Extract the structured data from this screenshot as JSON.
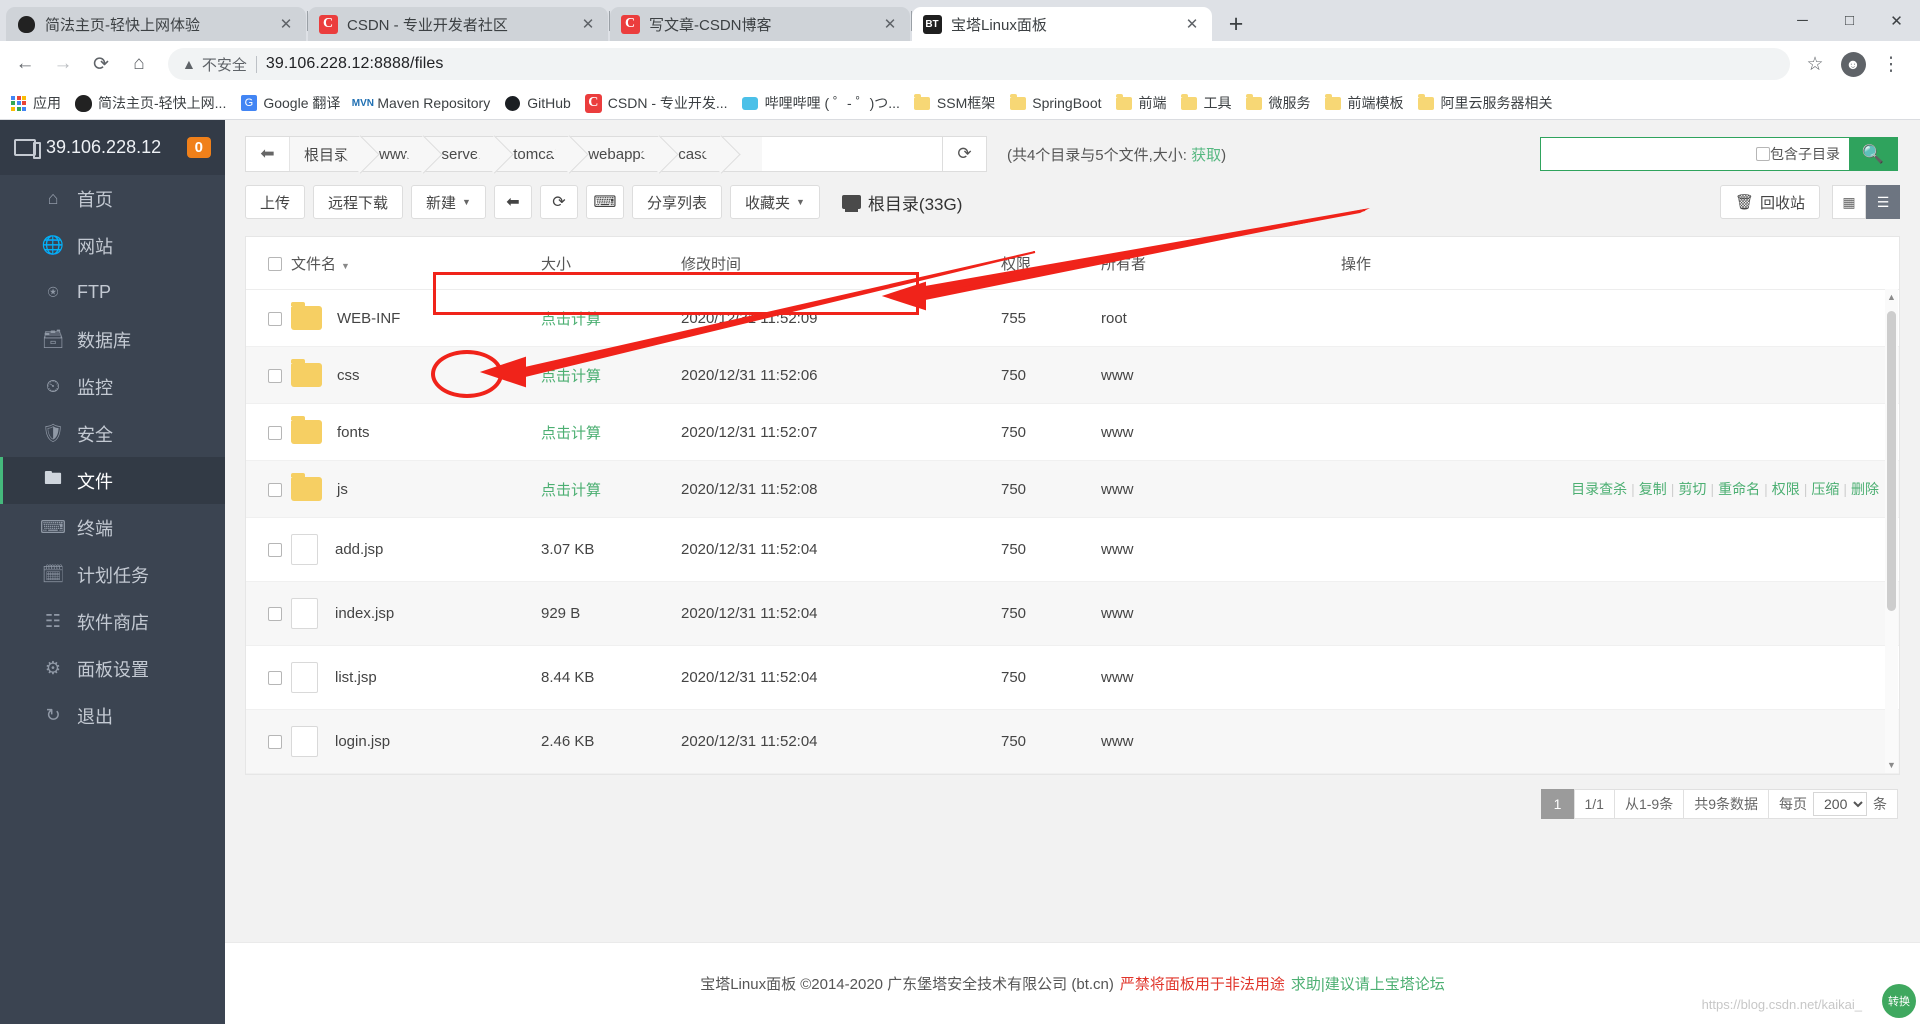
{
  "browser": {
    "tabs": [
      {
        "title": "简法主页-轻快上网体验",
        "favicon": "simplehome-icon",
        "active": false
      },
      {
        "title": "CSDN - 专业开发者社区",
        "favicon": "csdn-icon",
        "active": false
      },
      {
        "title": "写文章-CSDN博客",
        "favicon": "csdn-icon",
        "active": false
      },
      {
        "title": "宝塔Linux面板",
        "favicon": "bt-panel-icon",
        "active": true
      }
    ],
    "new_tab_label": "+",
    "window_controls": [
      "minimize",
      "maximize",
      "close"
    ],
    "nav": {
      "back": "back-arrow-icon",
      "forward": "forward-arrow-icon",
      "reload": "reload-icon",
      "home": "home-icon",
      "security_warning_icon": "warning-triangle-icon",
      "security_label": "不安全",
      "url": "39.106.228.12:8888/files",
      "star": "bookmark-star-icon",
      "profile": "profile-avatar-icon",
      "menu": "three-dot-menu-icon"
    },
    "bookmarks": [
      {
        "label": "应用",
        "icon": "apps-grid-icon"
      },
      {
        "label": "简法主页-轻快上网...",
        "icon": "simplehome-icon"
      },
      {
        "label": "Google 翻译",
        "icon": "google-translate-icon"
      },
      {
        "label": "Maven Repository",
        "icon": "maven-icon"
      },
      {
        "label": "GitHub",
        "icon": "github-icon"
      },
      {
        "label": "CSDN - 专业开发...",
        "icon": "csdn-icon"
      },
      {
        "label": "哔哩哔哩 ( ゜- ゜)つ...",
        "icon": "bilibili-icon"
      },
      {
        "label": "SSM框架",
        "icon": "folder-icon"
      },
      {
        "label": "SpringBoot",
        "icon": "folder-icon"
      },
      {
        "label": "前端",
        "icon": "folder-icon"
      },
      {
        "label": "工具",
        "icon": "folder-icon"
      },
      {
        "label": "微服务",
        "icon": "folder-icon"
      },
      {
        "label": "前端模板",
        "icon": "folder-icon"
      },
      {
        "label": "阿里云服务器相关",
        "icon": "folder-icon"
      }
    ]
  },
  "sidebar": {
    "server_ip": "39.106.228.12",
    "badge": "0",
    "monitor_icon": "monitor-icon",
    "items": [
      {
        "label": "首页",
        "icon": "home-icon",
        "active": false
      },
      {
        "label": "网站",
        "icon": "globe-icon",
        "active": false
      },
      {
        "label": "FTP",
        "icon": "ftp-globe-icon",
        "active": false
      },
      {
        "label": "数据库",
        "icon": "database-icon",
        "active": false
      },
      {
        "label": "监控",
        "icon": "monitor-chart-icon",
        "active": false
      },
      {
        "label": "安全",
        "icon": "shield-check-icon",
        "active": false
      },
      {
        "label": "文件",
        "icon": "folder-icon",
        "active": true
      },
      {
        "label": "终端",
        "icon": "terminal-icon",
        "active": false
      },
      {
        "label": "计划任务",
        "icon": "calendar-icon",
        "active": false
      },
      {
        "label": "软件商店",
        "icon": "apps-squares-icon",
        "active": false
      },
      {
        "label": "面板设置",
        "icon": "gear-icon",
        "active": false
      },
      {
        "label": "退出",
        "icon": "logout-icon",
        "active": false
      }
    ]
  },
  "path_bar": {
    "back_icon": "back-arrow-icon",
    "crumbs": [
      "根目录",
      "www",
      "server",
      "tomcat",
      "webapps",
      "case"
    ],
    "refresh_icon": "refresh-icon",
    "dir_info_prefix": "(共4个目录与5个文件,大小: ",
    "dir_info_link": "获取",
    "dir_info_suffix": ")"
  },
  "search": {
    "value": "",
    "placeholder": "",
    "include_sub_label": "包含子目录",
    "include_sub_checked": false,
    "search_icon": "search-icon"
  },
  "toolbar": {
    "upload_label": "上传",
    "remote_download_label": "远程下载",
    "new_label": "新建",
    "back_icon": "back-arrow-icon",
    "refresh_icon": "refresh-icon",
    "terminal_icon": "terminal-icon",
    "share_list_label": "分享列表",
    "favorites_label": "收藏夹",
    "root_label": "根目录(33G)",
    "disk_icon": "disk-icon",
    "recycle_label": "回收站",
    "recycle_icon": "trash-icon",
    "view_grid_icon": "grid-view-icon",
    "view_list_icon": "list-view-icon",
    "view_active": "list"
  },
  "table": {
    "select_all_checked": false,
    "columns": [
      "文件名",
      "大小",
      "修改时间",
      "权限",
      "所有者",
      "操作"
    ],
    "sort_column": "文件名",
    "rows": [
      {
        "name": "WEB-INF",
        "type": "folder",
        "size": "点击计算",
        "size_is_link": true,
        "mtime": "2020/12/31 11:52:09",
        "perm": "755",
        "owner": "root",
        "checked": false,
        "highlight": false
      },
      {
        "name": "css",
        "type": "folder",
        "size": "点击计算",
        "size_is_link": true,
        "mtime": "2020/12/31 11:52:06",
        "perm": "750",
        "owner": "www",
        "checked": false,
        "highlight": true
      },
      {
        "name": "fonts",
        "type": "folder",
        "size": "点击计算",
        "size_is_link": true,
        "mtime": "2020/12/31 11:52:07",
        "perm": "750",
        "owner": "www",
        "checked": false,
        "highlight": false
      },
      {
        "name": "js",
        "type": "folder",
        "size": "点击计算",
        "size_is_link": true,
        "mtime": "2020/12/31 11:52:08",
        "perm": "750",
        "owner": "www",
        "checked": false,
        "highlight": true,
        "show_actions": true
      },
      {
        "name": "add.jsp",
        "type": "file",
        "size": "3.07 KB",
        "size_is_link": false,
        "mtime": "2020/12/31 11:52:04",
        "perm": "750",
        "owner": "www",
        "checked": false,
        "highlight": false
      },
      {
        "name": "index.jsp",
        "type": "file",
        "size": "929 B",
        "size_is_link": false,
        "mtime": "2020/12/31 11:52:04",
        "perm": "750",
        "owner": "www",
        "checked": false,
        "highlight": true
      },
      {
        "name": "list.jsp",
        "type": "file",
        "size": "8.44 KB",
        "size_is_link": false,
        "mtime": "2020/12/31 11:52:04",
        "perm": "750",
        "owner": "www",
        "checked": false,
        "highlight": false
      },
      {
        "name": "login.jsp",
        "type": "file",
        "size": "2.46 KB",
        "size_is_link": false,
        "mtime": "2020/12/31 11:52:04",
        "perm": "750",
        "owner": "www",
        "checked": false,
        "highlight": true
      }
    ],
    "row_actions": [
      "目录查杀",
      "复制",
      "剪切",
      "重命名",
      "权限",
      "压缩",
      "删除"
    ]
  },
  "pagination": {
    "current_page": "1",
    "page_of": "1/1",
    "range": "从1-9条",
    "total": "共9条数据",
    "per_page_label": "每页",
    "per_page_value": "200",
    "per_page_unit": "条"
  },
  "footer": {
    "copyright": "宝塔Linux面板 ©2014-2020 广东堡塔安全技术有限公司 (bt.cn)",
    "warning": "严禁将面板用于非法用途",
    "help": "求助|建议请上宝塔论坛",
    "watermark": "https://blog.csdn.net/kaikai_",
    "qr_label": "转换"
  },
  "colors": {
    "accent_green": "#45b97c",
    "sidebar_bg": "#3b4451",
    "annotation_red": "#f0231a",
    "badge_orange": "#f0801a",
    "folder_yellow": "#f6cf63"
  }
}
